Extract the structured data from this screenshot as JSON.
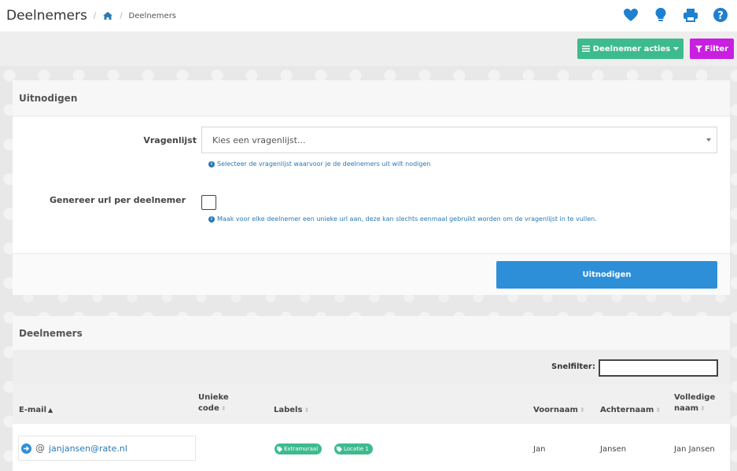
{
  "header": {
    "title": "Deelnemers",
    "breadcrumb_separator": "/",
    "breadcrumb_current": "Deelnemers",
    "icons": [
      "heart-icon",
      "lightbulb-icon",
      "print-icon",
      "help-icon"
    ],
    "icon_color": "#1f7fd1"
  },
  "toolbar": {
    "actions_label": "Deelnemer acties",
    "filter_label": "Filter",
    "actions_color": "#3dbb8e",
    "filter_color": "#c81fe0"
  },
  "invite": {
    "title": "Uitnodigen",
    "questionnaire_label": "Vragenlijst",
    "questionnaire_placeholder": "Kies een vragenlijst...",
    "questionnaire_help": "Selecteer de vragenlijst waarvoor je de deelnemers uit wilt nodigen",
    "url_label": "Genereer url per deelnemer",
    "url_help": "Maak voor elke deelnemer een unieke url aan, deze kan slechts eenmaal gebruikt worden om de vragenlijst in te vullen.",
    "url_checked": false,
    "submit_label": "Uitnodigen",
    "submit_color": "#2e8fd9"
  },
  "participants": {
    "title": "Deelnemers",
    "quickfilter_label": "Snelfilter:",
    "quickfilter_value": "",
    "columns": {
      "email": "E-mail",
      "code_line1": "Unieke",
      "code_line2": "code",
      "labels": "Labels",
      "first_name": "Voornaam",
      "last_name": "Achternaam",
      "full_name_line1": "Volledige",
      "full_name_line2": "naam"
    },
    "rows": [
      {
        "email": "janjansen@rate.nl",
        "code": "",
        "labels": [
          "Extramuraal",
          "Locatie 1"
        ],
        "first_name": "Jan",
        "last_name": "Jansen",
        "full_name": "Jan Jansen"
      }
    ],
    "label_color": "#3dbb8e"
  }
}
